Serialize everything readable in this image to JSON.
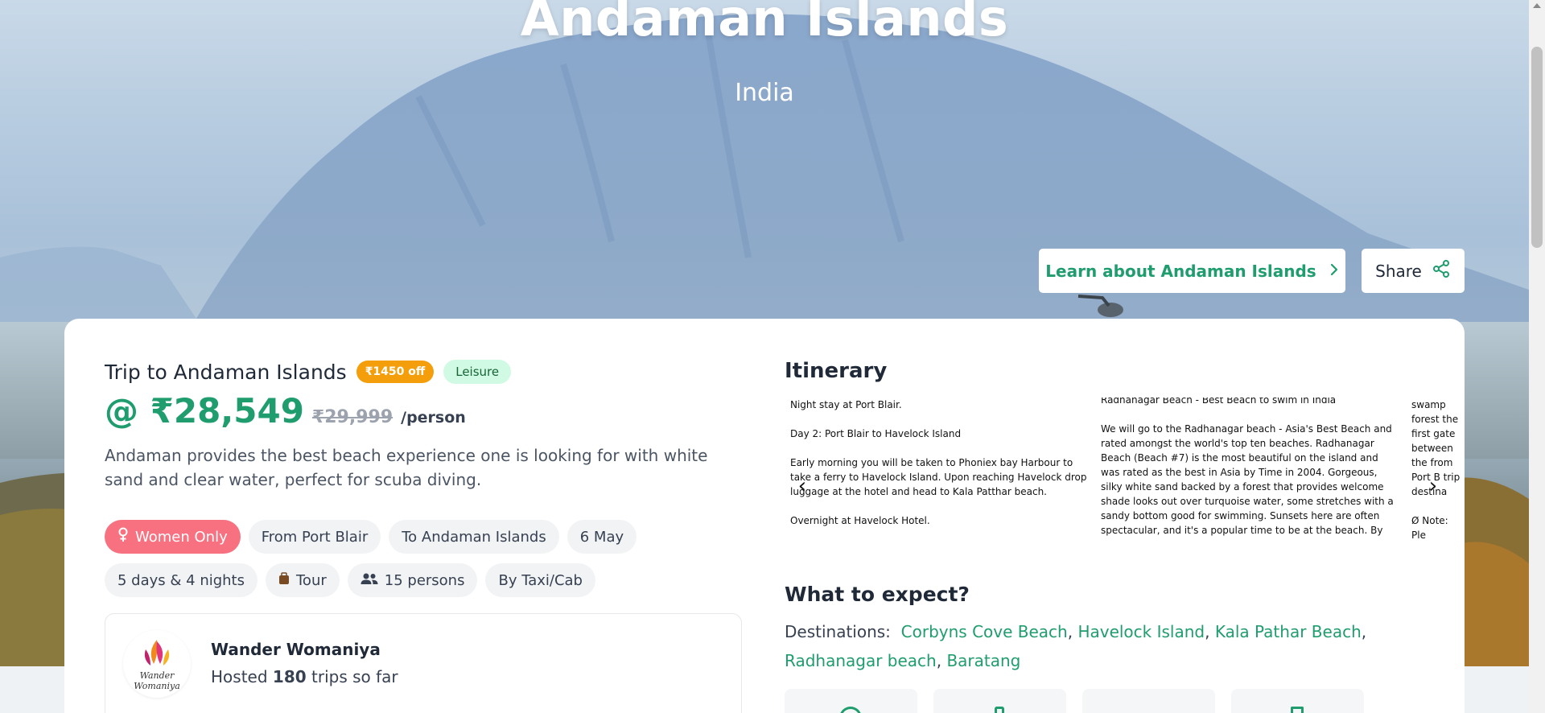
{
  "hero": {
    "title": "Andaman Islands",
    "subtitle": "India",
    "learn_label": "Learn about Andaman Islands",
    "share_label": "Share"
  },
  "trip": {
    "title": "Trip to Andaman Islands",
    "discount": "₹1450 off",
    "category": "Leisure",
    "price": "@ ₹28,549",
    "old_price": "₹29,999",
    "per": "/person",
    "description": "Andaman provides the best beach experience one is looking for with white sand and clear water, perfect for scuba diving."
  },
  "tags": {
    "women": "Women Only",
    "from": "From Port Blair",
    "to": "To Andaman Islands",
    "date": "6 May",
    "duration": "5 days & 4 nights",
    "type": "Tour",
    "persons": "15 persons",
    "transport": "By Taxi/Cab"
  },
  "host": {
    "name": "Wander Womaniya",
    "prefix": "Hosted",
    "count": "180",
    "suffix": "trips so far",
    "logo_text_1": "Wander",
    "logo_text_2": "Womaniya"
  },
  "itinerary": {
    "heading": "Itinerary",
    "card1": {
      "p1": "Night stay at Port Blair.",
      "p2": "Day 2: Port Blair to Havelock Island",
      "p3": "Early morning you will be taken to Phoniex bay Harbour to take a ferry to Havelock Island. Upon reaching Havelock drop luggage at the hotel and head to Kala Patthar beach.",
      "p4": "Overnight at Havelock Hotel."
    },
    "card2": {
      "p1": "Radhanagar Beach - Best Beach to swim in India",
      "p2": "We will go to the Radhanagar beach - Asia's Best Beach and rated amongst the world's top ten beaches. Radhanagar Beach (Beach #7) is the most beautiful on the island and was rated as the best in Asia by Time in 2004. Gorgeous, silky white sand backed by a forest that provides welcome shade looks out over turquoise water, some stretches with a sandy bottom good for swimming. Sunsets here are often spectacular, and it's a popular time to be at the beach. By evening, return to the hotel and stay overnight at Havelock Island. So get your Bikini"
    },
    "card3": {
      "p1": "swamp forest the first gate between the from Port B trip destina",
      "p2": "Ø Note: Ple sunglasses, packed foo at this loca"
    }
  },
  "expect": {
    "heading": "What to expect?",
    "dest_label": "Destinations:",
    "destinations": [
      "Corbyns Cove Beach",
      "Havelock Island",
      "Kala Pathar Beach",
      "Radhanagar beach",
      "Baratang"
    ]
  },
  "colors": {
    "accent": "#1f9d6e",
    "discount": "#f59e0b",
    "women_tag": "#f87180",
    "category_bg": "#d1fae5"
  },
  "icons": {
    "learn": "chevron-right-icon",
    "share": "share-icon",
    "women": "female-icon",
    "tour": "luggage-icon",
    "persons": "people-icon"
  }
}
